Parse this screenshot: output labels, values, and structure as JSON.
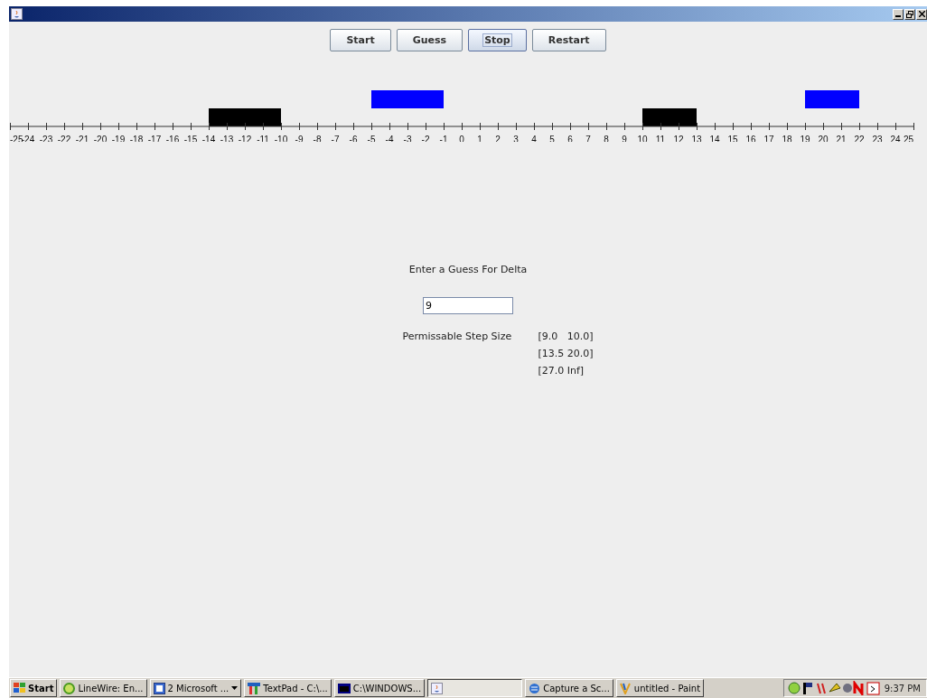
{
  "buttons": [
    {
      "label": "Start",
      "focused": false
    },
    {
      "label": "Guess",
      "focused": false
    },
    {
      "label": "Stop",
      "focused": true
    },
    {
      "label": "Restart",
      "focused": false
    }
  ],
  "number_line": {
    "ticks": [
      {
        "label": "-25",
        "kind": "plain"
      },
      {
        "label": "-24",
        "kind": "plain"
      },
      {
        "label": "-23",
        "kind": "plain"
      },
      {
        "label": "-22",
        "kind": "plain"
      },
      {
        "label": "-21",
        "kind": "plain"
      },
      {
        "label": "-20",
        "kind": "plain"
      },
      {
        "label": "-19",
        "kind": "plain"
      },
      {
        "label": "-18",
        "kind": "plain"
      },
      {
        "label": "-17",
        "kind": "plain"
      },
      {
        "label": "-16",
        "kind": "plain"
      },
      {
        "label": "-15",
        "kind": "plain"
      },
      {
        "label": "-14",
        "kind": "lower"
      },
      {
        "label": "-13",
        "kind": "lower"
      },
      {
        "label": "-12",
        "kind": "lower"
      },
      {
        "label": "-11",
        "kind": "lower"
      },
      {
        "label": "-10",
        "kind": "plain"
      },
      {
        "label": "-9",
        "kind": "plain"
      },
      {
        "label": "-8",
        "kind": "plain"
      },
      {
        "label": "-7",
        "kind": "plain"
      },
      {
        "label": "-6",
        "kind": "plain"
      },
      {
        "label": "-5",
        "kind": "upper"
      },
      {
        "label": "-4",
        "kind": "upper"
      },
      {
        "label": "-3",
        "kind": "upper"
      },
      {
        "label": "-2",
        "kind": "upper"
      },
      {
        "label": "-1",
        "kind": "plain"
      },
      {
        "label": "0",
        "kind": "plain"
      },
      {
        "label": "1",
        "kind": "plain"
      },
      {
        "label": "2",
        "kind": "plain"
      },
      {
        "label": "3",
        "kind": "plain"
      },
      {
        "label": "4",
        "kind": "plain"
      },
      {
        "label": "5",
        "kind": "plain"
      },
      {
        "label": "6",
        "kind": "plain"
      },
      {
        "label": "7",
        "kind": "plain"
      },
      {
        "label": "8",
        "kind": "plain"
      },
      {
        "label": "9",
        "kind": "plain"
      },
      {
        "label": "10",
        "kind": "lower"
      },
      {
        "label": "11",
        "kind": "lower"
      },
      {
        "label": "12",
        "kind": "lower"
      },
      {
        "label": "13",
        "kind": "plain"
      },
      {
        "label": "14",
        "kind": "plain"
      },
      {
        "label": "15",
        "kind": "plain"
      },
      {
        "label": "16",
        "kind": "plain"
      },
      {
        "label": "17",
        "kind": "plain"
      },
      {
        "label": "18",
        "kind": "plain"
      },
      {
        "label": "19",
        "kind": "upper"
      },
      {
        "label": "20",
        "kind": "upper"
      },
      {
        "label": "21",
        "kind": "upper"
      },
      {
        "label": "22",
        "kind": "plain"
      },
      {
        "label": "23",
        "kind": "plain"
      },
      {
        "label": "24",
        "kind": "plain"
      },
      {
        "label": "25",
        "kind": "plain"
      }
    ]
  },
  "prompt": "Enter a Guess For Delta",
  "guess_field": {
    "value": "9"
  },
  "step_size": {
    "label": "Permissable Step Size",
    "ranges": [
      "[9.0   10.0]",
      "[13.5 20.0]",
      "[27.0 Inf]"
    ]
  },
  "taskbar": {
    "start": "Start",
    "items": [
      {
        "label": "LineWire: En...",
        "kind": "circle",
        "selected": false
      },
      {
        "label": "2 Microsoft ...",
        "kind": "word",
        "selected": false,
        "menu": true
      },
      {
        "label": "TextPad - C:\\...",
        "kind": "textpad",
        "selected": false
      },
      {
        "label": "C:\\WINDOWS...",
        "kind": "console",
        "selected": false
      },
      {
        "kind": "java",
        "selected": true
      },
      {
        "label": "Capture a Sc...",
        "kind": "globe",
        "selected": false
      },
      {
        "label": "untitled - Paint",
        "kind": "paint",
        "selected": false
      }
    ],
    "clock": "9:37 PM"
  }
}
